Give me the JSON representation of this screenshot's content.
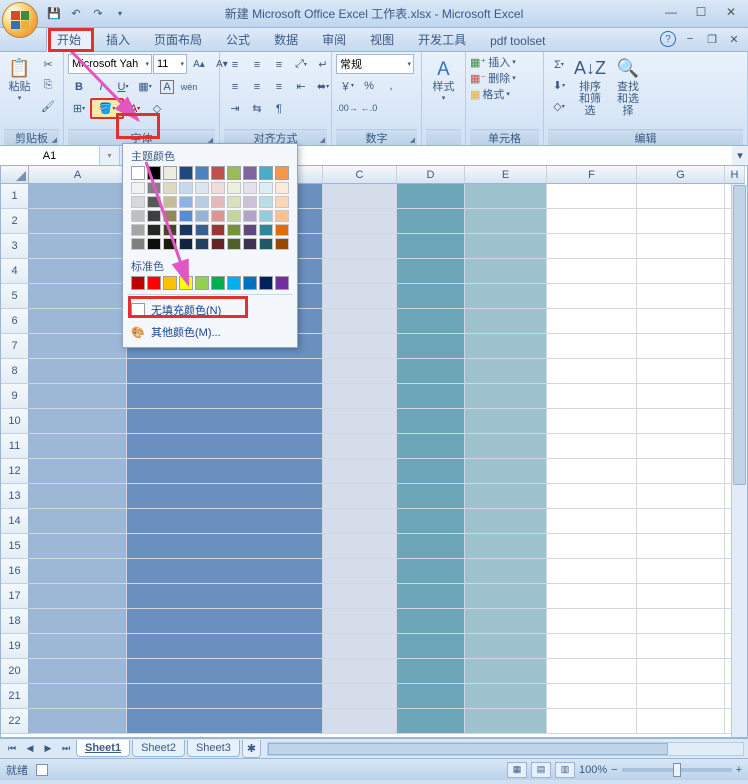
{
  "title": "新建 Microsoft Office Excel 工作表.xlsx - Microsoft Excel",
  "tabs": {
    "home": "开始",
    "insert": "插入",
    "layout": "页面布局",
    "formula": "公式",
    "data": "数据",
    "review": "审阅",
    "view": "视图",
    "dev": "开发工具",
    "pdf": "pdf toolset"
  },
  "ribbon": {
    "clipboard": {
      "paste": "粘贴",
      "label": "剪贴板"
    },
    "font": {
      "name": "Microsoft Yah",
      "size": "11",
      "label": "字体"
    },
    "align": {
      "label": "对齐方式"
    },
    "number": {
      "format": "常规",
      "label": "数字"
    },
    "styles": {
      "btn": "样式",
      "label": ""
    },
    "cells": {
      "insert": "插入",
      "delete": "删除",
      "format": "格式",
      "label": "单元格"
    },
    "editing": {
      "sort": "排序和筛选",
      "find": "查找和选择",
      "label": "编辑"
    }
  },
  "picker": {
    "theme_title": "主题颜色",
    "standard_title": "标准色",
    "no_fill": "无填充颜色(N)",
    "more_colors": "其他颜色(M)...",
    "theme_row": [
      "#ffffff",
      "#000000",
      "#eeece1",
      "#1f497d",
      "#4f81bd",
      "#c0504d",
      "#9bbb59",
      "#8064a2",
      "#4bacc6",
      "#f79646"
    ],
    "theme_shades": [
      [
        "#f2f2f2",
        "#7f7f7f",
        "#ddd9c3",
        "#c6d9f0",
        "#dbe5f1",
        "#f2dcdb",
        "#ebf1dd",
        "#e5e0ec",
        "#dbeef3",
        "#fdeada"
      ],
      [
        "#d8d8d8",
        "#595959",
        "#c4bd97",
        "#8db3e2",
        "#b8cce4",
        "#e5b9b7",
        "#d7e3bc",
        "#ccc1d9",
        "#b7dde8",
        "#fbd5b5"
      ],
      [
        "#bfbfbf",
        "#3f3f3f",
        "#938953",
        "#548dd4",
        "#95b3d7",
        "#d99694",
        "#c3d69b",
        "#b2a2c7",
        "#92cddc",
        "#fac08f"
      ],
      [
        "#a5a5a5",
        "#262626",
        "#494429",
        "#17365d",
        "#366092",
        "#953734",
        "#76923c",
        "#5f497a",
        "#31859b",
        "#e36c09"
      ],
      [
        "#7f7f7f",
        "#0c0c0c",
        "#1d1b10",
        "#0f243e",
        "#244061",
        "#632423",
        "#4f6128",
        "#3f3151",
        "#205867",
        "#974806"
      ]
    ],
    "standard": [
      "#c00000",
      "#ff0000",
      "#ffc000",
      "#ffff00",
      "#92d050",
      "#00b050",
      "#00b0f0",
      "#0070c0",
      "#002060",
      "#7030a0"
    ]
  },
  "namebox": "A1",
  "columns": [
    "A",
    "B",
    "C",
    "D",
    "E",
    "F",
    "G",
    "H"
  ],
  "row_count": 22,
  "sheets": {
    "s1": "Sheet1",
    "s2": "Sheet2",
    "s3": "Sheet3"
  },
  "status": {
    "ready": "就绪",
    "rec": "",
    "zoom": "100%"
  }
}
